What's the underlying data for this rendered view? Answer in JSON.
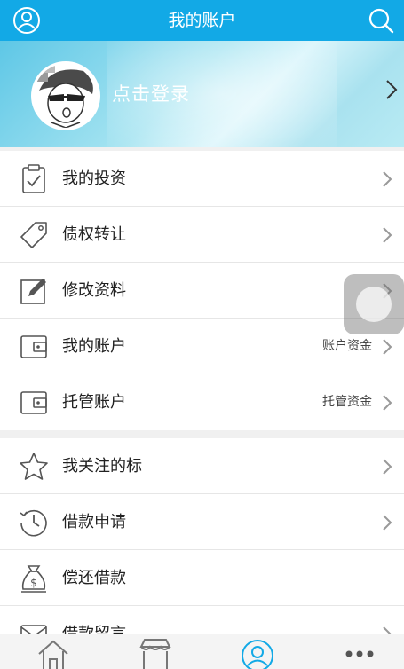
{
  "header": {
    "title": "我的账户",
    "left_icon": "user-icon",
    "right_icon": "search-icon"
  },
  "profile": {
    "login_text": "点击登录",
    "avatar_icon": "avatar-icon"
  },
  "menu_group_1": [
    {
      "label": "我的投资",
      "icon": "clipboard-check-icon"
    },
    {
      "label": "债权转让",
      "icon": "tag-icon"
    },
    {
      "label": "修改资料",
      "icon": "edit-icon"
    },
    {
      "label": "我的账户",
      "icon": "wallet-icon",
      "extra": "账户资金"
    },
    {
      "label": "托管账户",
      "icon": "wallet-icon",
      "extra": "托管资金"
    }
  ],
  "menu_group_2": [
    {
      "label": "我关注的标",
      "icon": "star-icon"
    },
    {
      "label": "借款申请",
      "icon": "clock-icon"
    },
    {
      "label": "偿还借款",
      "icon": "money-bag-icon"
    },
    {
      "label": "借款留言",
      "icon": "message-icon"
    }
  ],
  "tabbar": [
    {
      "icon": "home-icon"
    },
    {
      "icon": "store-icon"
    },
    {
      "icon": "account-icon",
      "active": true
    },
    {
      "icon": "more-icon"
    }
  ],
  "colors": {
    "accent": "#12a9e6",
    "text": "#222222",
    "divider": "#e6e6e6"
  }
}
